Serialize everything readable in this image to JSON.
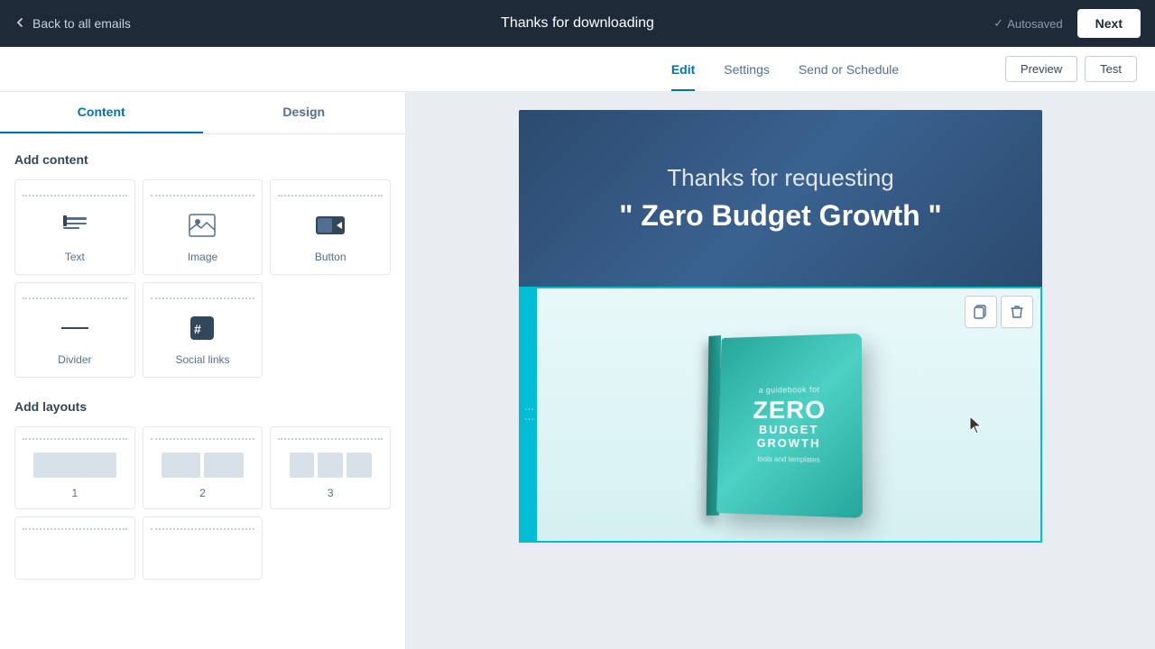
{
  "topNav": {
    "backLabel": "Back to all emails",
    "title": "Thanks for downloading",
    "autosaved": "Autosaved",
    "nextLabel": "Next"
  },
  "secondaryNav": {
    "tabs": [
      {
        "id": "edit",
        "label": "Edit",
        "active": true
      },
      {
        "id": "settings",
        "label": "Settings",
        "active": false
      },
      {
        "id": "send-schedule",
        "label": "Send or Schedule",
        "active": false
      }
    ],
    "buttons": [
      {
        "id": "preview",
        "label": "Preview"
      },
      {
        "id": "test",
        "label": "Test"
      }
    ]
  },
  "sidebar": {
    "tabs": [
      {
        "id": "content",
        "label": "Content",
        "active": true
      },
      {
        "id": "design",
        "label": "Design",
        "active": false
      }
    ],
    "addContent": {
      "title": "Add content",
      "blocks": [
        {
          "id": "text",
          "label": "Text",
          "icon": "text-icon"
        },
        {
          "id": "image",
          "label": "Image",
          "icon": "image-icon"
        },
        {
          "id": "button",
          "label": "Button",
          "icon": "button-icon"
        },
        {
          "id": "divider",
          "label": "Divider",
          "icon": "divider-icon"
        },
        {
          "id": "social-links",
          "label": "Social links",
          "icon": "social-icon"
        }
      ]
    },
    "addLayouts": {
      "title": "Add layouts",
      "layouts": [
        {
          "id": "1",
          "label": "1",
          "cols": 1
        },
        {
          "id": "2",
          "label": "2",
          "cols": 2
        },
        {
          "id": "3",
          "label": "3",
          "cols": 3
        }
      ]
    }
  },
  "emailCanvas": {
    "header": {
      "line1": "Thanks for requesting",
      "line2": "\" Zero Budget Growth \""
    },
    "imageBlock": {
      "bookSubtitle": "a guidebook for",
      "bookTitleZero": "ZERO",
      "bookTitleBudget": "BUDGET GROWTH",
      "bookTools": "tools and templates"
    }
  }
}
